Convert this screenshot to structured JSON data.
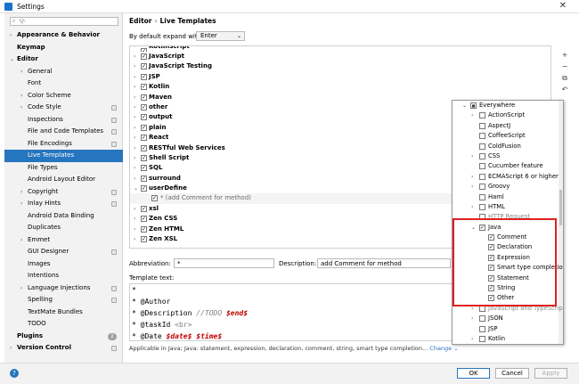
{
  "window": {
    "title": "Settings",
    "close_icon": "close-icon"
  },
  "search": {
    "placeholder": "Q-",
    "value": ""
  },
  "nav_tree": [
    {
      "label": "Appearance & Behavior",
      "arrow": ">",
      "level": 0,
      "bold": true
    },
    {
      "label": "Keymap",
      "arrow": "",
      "level": 0,
      "bold": true
    },
    {
      "label": "Editor",
      "arrow": "v",
      "level": 0,
      "bold": true
    },
    {
      "label": "General",
      "arrow": ">",
      "level": 1
    },
    {
      "label": "Font",
      "arrow": "",
      "level": 1
    },
    {
      "label": "Color Scheme",
      "arrow": ">",
      "level": 1
    },
    {
      "label": "Code Style",
      "arrow": ">",
      "level": 1,
      "proj": true
    },
    {
      "label": "Inspections",
      "arrow": "",
      "level": 1,
      "proj": true
    },
    {
      "label": "File and Code Templates",
      "arrow": "",
      "level": 1,
      "proj": true
    },
    {
      "label": "File Encodings",
      "arrow": "",
      "level": 1,
      "proj": true
    },
    {
      "label": "Live Templates",
      "arrow": "",
      "level": 1,
      "selected": true
    },
    {
      "label": "File Types",
      "arrow": "",
      "level": 1
    },
    {
      "label": "Android Layout Editor",
      "arrow": "",
      "level": 1
    },
    {
      "label": "Copyright",
      "arrow": ">",
      "level": 1,
      "proj": true
    },
    {
      "label": "Inlay Hints",
      "arrow": ">",
      "level": 1,
      "proj": true
    },
    {
      "label": "Android Data Binding",
      "arrow": "",
      "level": 1
    },
    {
      "label": "Duplicates",
      "arrow": "",
      "level": 1
    },
    {
      "label": "Emmet",
      "arrow": ">",
      "level": 1
    },
    {
      "label": "GUI Designer",
      "arrow": "",
      "level": 1,
      "proj": true
    },
    {
      "label": "Images",
      "arrow": "",
      "level": 1
    },
    {
      "label": "Intentions",
      "arrow": "",
      "level": 1
    },
    {
      "label": "Language Injections",
      "arrow": ">",
      "level": 1,
      "proj": true
    },
    {
      "label": "Spelling",
      "arrow": "",
      "level": 1,
      "proj": true
    },
    {
      "label": "TextMate Bundles",
      "arrow": "",
      "level": 1
    },
    {
      "label": "TODO",
      "arrow": "",
      "level": 1
    },
    {
      "label": "Plugins",
      "arrow": "",
      "level": 0,
      "bold": true,
      "badge": "2"
    },
    {
      "label": "Version Control",
      "arrow": ">",
      "level": 0,
      "bold": true,
      "proj": true
    }
  ],
  "breadcrumb": {
    "parent": "Editor",
    "sep": "›",
    "current": "Live Templates"
  },
  "expand": {
    "label": "By default expand with",
    "value": "Enter"
  },
  "template_groups": [
    {
      "name": "Kotlinscript",
      "arrow": ">",
      "checked": true,
      "clipped": true
    },
    {
      "name": "JavaScript",
      "arrow": ">",
      "checked": true
    },
    {
      "name": "JavaScript Testing",
      "arrow": ">",
      "checked": true
    },
    {
      "name": "JSP",
      "arrow": ">",
      "checked": true
    },
    {
      "name": "Kotlin",
      "arrow": ">",
      "checked": true
    },
    {
      "name": "Maven",
      "arrow": ">",
      "checked": true
    },
    {
      "name": "other",
      "arrow": ">",
      "checked": true
    },
    {
      "name": "output",
      "arrow": ">",
      "checked": true
    },
    {
      "name": "plain",
      "arrow": ">",
      "checked": true
    },
    {
      "name": "React",
      "arrow": ">",
      "checked": true
    },
    {
      "name": "RESTful Web Services",
      "arrow": ">",
      "checked": true
    },
    {
      "name": "Shell Script",
      "arrow": ">",
      "checked": true
    },
    {
      "name": "SQL",
      "arrow": ">",
      "checked": true
    },
    {
      "name": "surround",
      "arrow": ">",
      "checked": true
    },
    {
      "name": "userDefine",
      "arrow": "v",
      "checked": true
    },
    {
      "name": "* (add Comment for method)",
      "arrow": "",
      "checked": true,
      "child": true
    },
    {
      "name": "xsl",
      "arrow": ">",
      "checked": true
    },
    {
      "name": "Zen CSS",
      "arrow": ">",
      "checked": true
    },
    {
      "name": "Zen HTML",
      "arrow": ">",
      "checked": true
    },
    {
      "name": "Zen XSL",
      "arrow": ">",
      "checked": true
    }
  ],
  "tools": [
    "+",
    "−",
    "⧉",
    "↶"
  ],
  "abbreviation": {
    "label": "Abbreviation:",
    "value": "*"
  },
  "description": {
    "label": "Description:",
    "value": "add Comment for method"
  },
  "template_text_label": "Template text:",
  "template_lines": [
    [
      {
        "t": "*",
        "c": ""
      }
    ],
    [
      {
        "t": " * @Author",
        "c": ""
      }
    ],
    [
      {
        "t": " * @Description ",
        "c": ""
      },
      {
        "t": "//TODO ",
        "c": "comment"
      },
      {
        "t": "$end$",
        "c": "var"
      }
    ],
    [
      {
        "t": " * @taskId ",
        "c": ""
      },
      {
        "t": "<br>",
        "c": "lt"
      }
    ],
    [
      {
        "t": " * @Date ",
        "c": ""
      },
      {
        "t": "$date$",
        "c": "var"
      },
      {
        "t": " ",
        "c": ""
      },
      {
        "t": "$time$",
        "c": "var"
      }
    ]
  ],
  "applicable": {
    "text": "Applicable in Java; Java: statement, expression, declaration, comment, string, smart type completion...",
    "link": "Change ⌄"
  },
  "buttons": {
    "ok": "OK",
    "cancel": "Cancel",
    "apply": "Apply"
  },
  "context_popup": [
    {
      "name": "Everywhere",
      "level": 0,
      "arrow": "v",
      "state": "partial"
    },
    {
      "name": "ActionScript",
      "level": 1,
      "arrow": ">",
      "state": "off"
    },
    {
      "name": "AspectJ",
      "level": 1,
      "arrow": "",
      "state": "off"
    },
    {
      "name": "CoffeeScript",
      "level": 1,
      "arrow": "",
      "state": "off"
    },
    {
      "name": "ColdFusion",
      "level": 1,
      "arrow": "",
      "state": "off"
    },
    {
      "name": "CSS",
      "level": 1,
      "arrow": ">",
      "state": "off"
    },
    {
      "name": "Cucumber feature",
      "level": 1,
      "arrow": "",
      "state": "off"
    },
    {
      "name": "ECMAScript 6 or higher",
      "level": 1,
      "arrow": ">",
      "state": "off"
    },
    {
      "name": "Groovy",
      "level": 1,
      "arrow": ">",
      "state": "off"
    },
    {
      "name": "Haml",
      "level": 1,
      "arrow": "",
      "state": "off"
    },
    {
      "name": "HTML",
      "level": 1,
      "arrow": ">",
      "state": "off"
    },
    {
      "name": "HTTP Request",
      "level": 1,
      "arrow": "",
      "state": "off",
      "covered": true
    },
    {
      "name": "Java",
      "level": 1,
      "arrow": "v",
      "state": "on"
    },
    {
      "name": "Comment",
      "level": 2,
      "arrow": "",
      "state": "on"
    },
    {
      "name": "Declaration",
      "level": 2,
      "arrow": "",
      "state": "on"
    },
    {
      "name": "Expression",
      "level": 2,
      "arrow": "",
      "state": "on"
    },
    {
      "name": "Smart type completion",
      "level": 2,
      "arrow": "",
      "state": "on"
    },
    {
      "name": "Statement",
      "level": 2,
      "arrow": "",
      "state": "on"
    },
    {
      "name": "String",
      "level": 2,
      "arrow": "",
      "state": "on"
    },
    {
      "name": "Other",
      "level": 2,
      "arrow": "",
      "state": "on"
    },
    {
      "name": "JavaScript and TypeScript",
      "level": 1,
      "arrow": ">",
      "state": "off",
      "covered": true
    },
    {
      "name": "JSON",
      "level": 1,
      "arrow": ">",
      "state": "off"
    },
    {
      "name": "JSP",
      "level": 1,
      "arrow": "",
      "state": "off"
    },
    {
      "name": "Kotlin",
      "level": 1,
      "arrow": ">",
      "state": "off"
    }
  ],
  "colors": {
    "accent": "#2675bf",
    "highlight_box": "#e02020",
    "var": "#c00000"
  }
}
